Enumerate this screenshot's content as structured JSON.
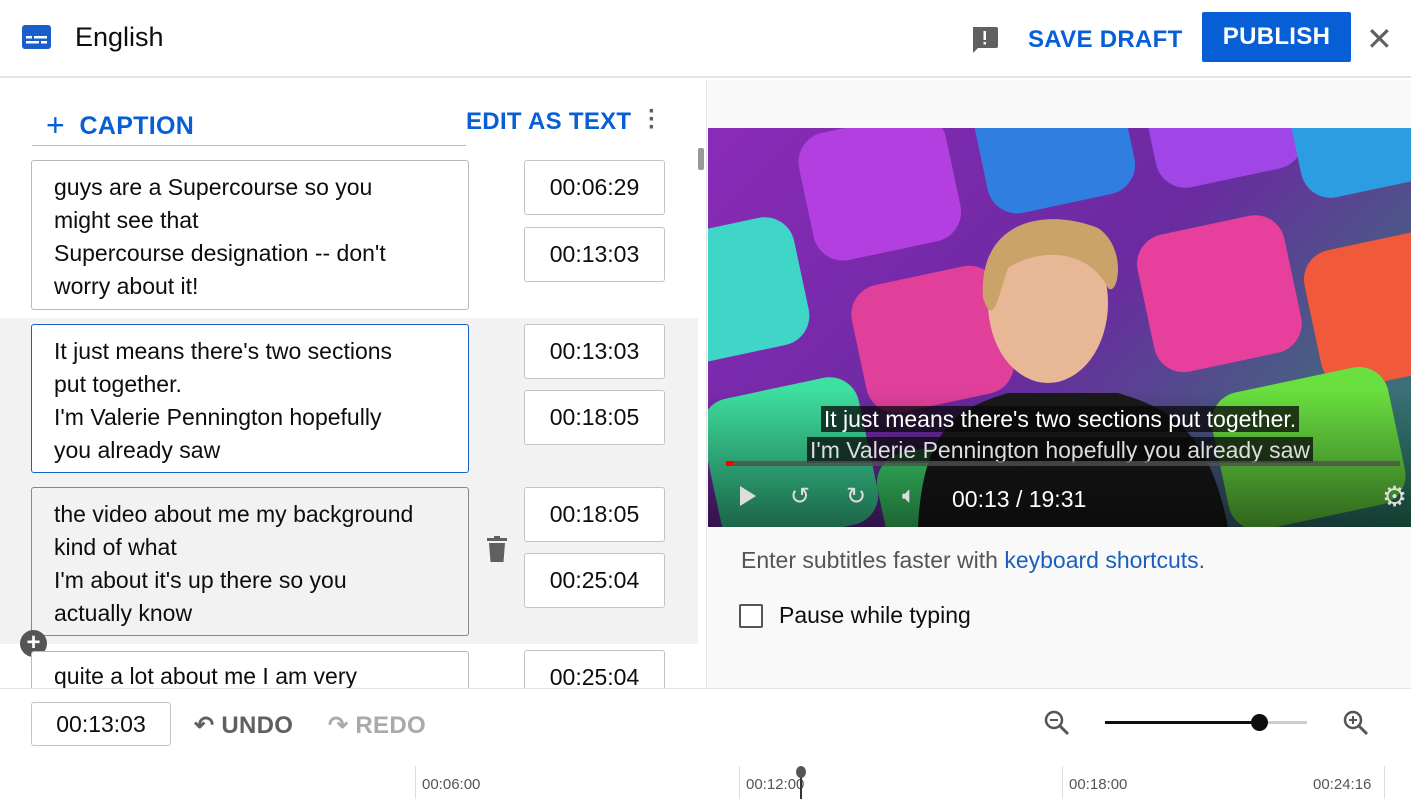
{
  "header": {
    "title": "English",
    "save_draft": "SAVE DRAFT",
    "publish": "PUBLISH",
    "icons": {
      "subtitles": "subtitles-icon",
      "feedback": "feedback-icon",
      "close": "close-icon"
    }
  },
  "toolbar": {
    "add_caption": "CAPTION",
    "edit_as_text": "EDIT AS TEXT"
  },
  "captions": [
    {
      "text": "guys are a Supercourse so you\nmight see that\nSupercourse designation -- don't\nworry about it!",
      "start": "00:06:29",
      "end": "00:13:03"
    },
    {
      "text": "It just means there's two sections\nput together.\nI'm Valerie Pennington hopefully\nyou already saw",
      "start": "00:13:03",
      "end": "00:18:05"
    },
    {
      "text": "the video about me my background\nkind of what\nI'm about it's up there so you\nactually know",
      "start": "00:18:05",
      "end": "00:25:04"
    },
    {
      "text": "quite a lot about me I am very",
      "start": "00:25:04"
    }
  ],
  "player": {
    "subtitle_line1": "It just means there's two sections put together.",
    "subtitle_line2": "I'm Valerie Pennington hopefully you already saw",
    "time": "00:13 / 19:31",
    "progress": 0.011
  },
  "hint": {
    "text": "Enter subtitles faster with ",
    "link": "keyboard shortcuts",
    "end": "."
  },
  "pause_while_typing": {
    "label": "Pause while typing",
    "checked": false
  },
  "bottom": {
    "current_time": "00:13:03",
    "undo": "UNDO",
    "redo": "REDO",
    "zoom_level": 0.76
  },
  "timeline": {
    "ticks": [
      "00:06:00",
      "00:12:00",
      "00:18:00",
      "00:24:16"
    ]
  },
  "colors": {
    "accent": "#065fd4",
    "publish_bg": "#065fd4"
  }
}
